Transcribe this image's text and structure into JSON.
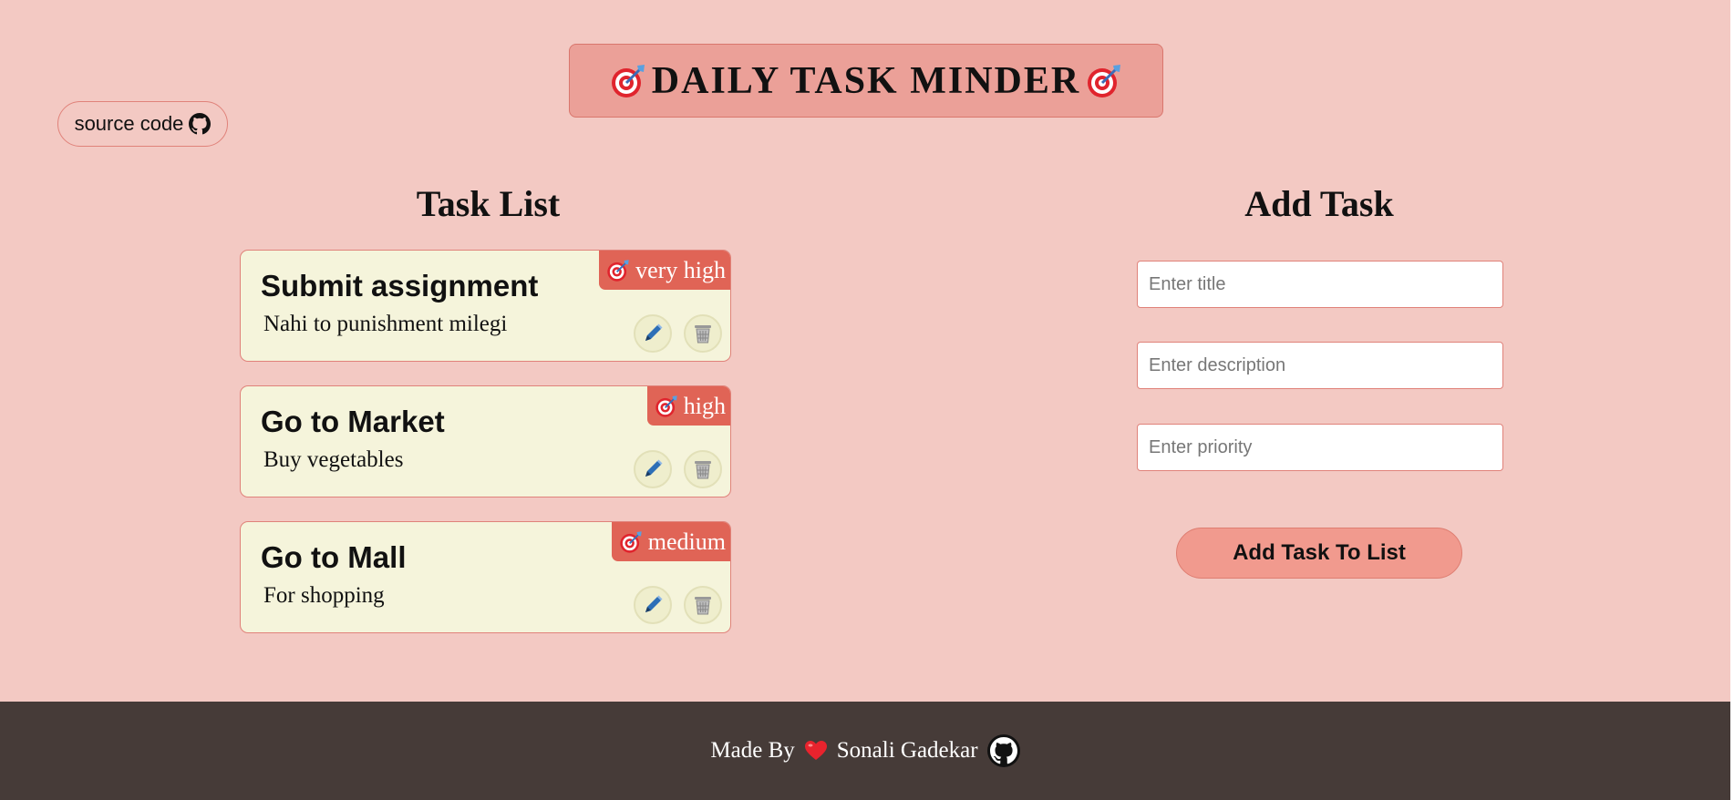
{
  "header": {
    "title": "DAILY TASK MINDER",
    "source_label": "source code"
  },
  "task_list": {
    "heading": "Task List",
    "tasks": [
      {
        "title": "Submit assignment",
        "description": "Nahi to punishment milegi",
        "priority": "very high"
      },
      {
        "title": "Go to Market",
        "description": "Buy vegetables",
        "priority": "high"
      },
      {
        "title": "Go to Mall",
        "description": "For shopping",
        "priority": "medium"
      }
    ]
  },
  "add_task": {
    "heading": "Add Task",
    "title_placeholder": "Enter title",
    "description_placeholder": "Enter description",
    "priority_placeholder": "Enter priority",
    "submit_label": "Add Task To List"
  },
  "footer": {
    "made_by": "Made By",
    "author": "Sonali Gadekar"
  },
  "colors": {
    "background": "#f3c9c3",
    "title_box": "#eba098",
    "card": "#f5f4db",
    "priority_badge": "#e06456",
    "add_button": "#f19a8e",
    "footer": "#463b38"
  },
  "icons": {
    "title": "target-icon",
    "source": "github-icon",
    "edit": "pencil-icon",
    "delete": "trash-icon",
    "heart": "heart-icon"
  }
}
